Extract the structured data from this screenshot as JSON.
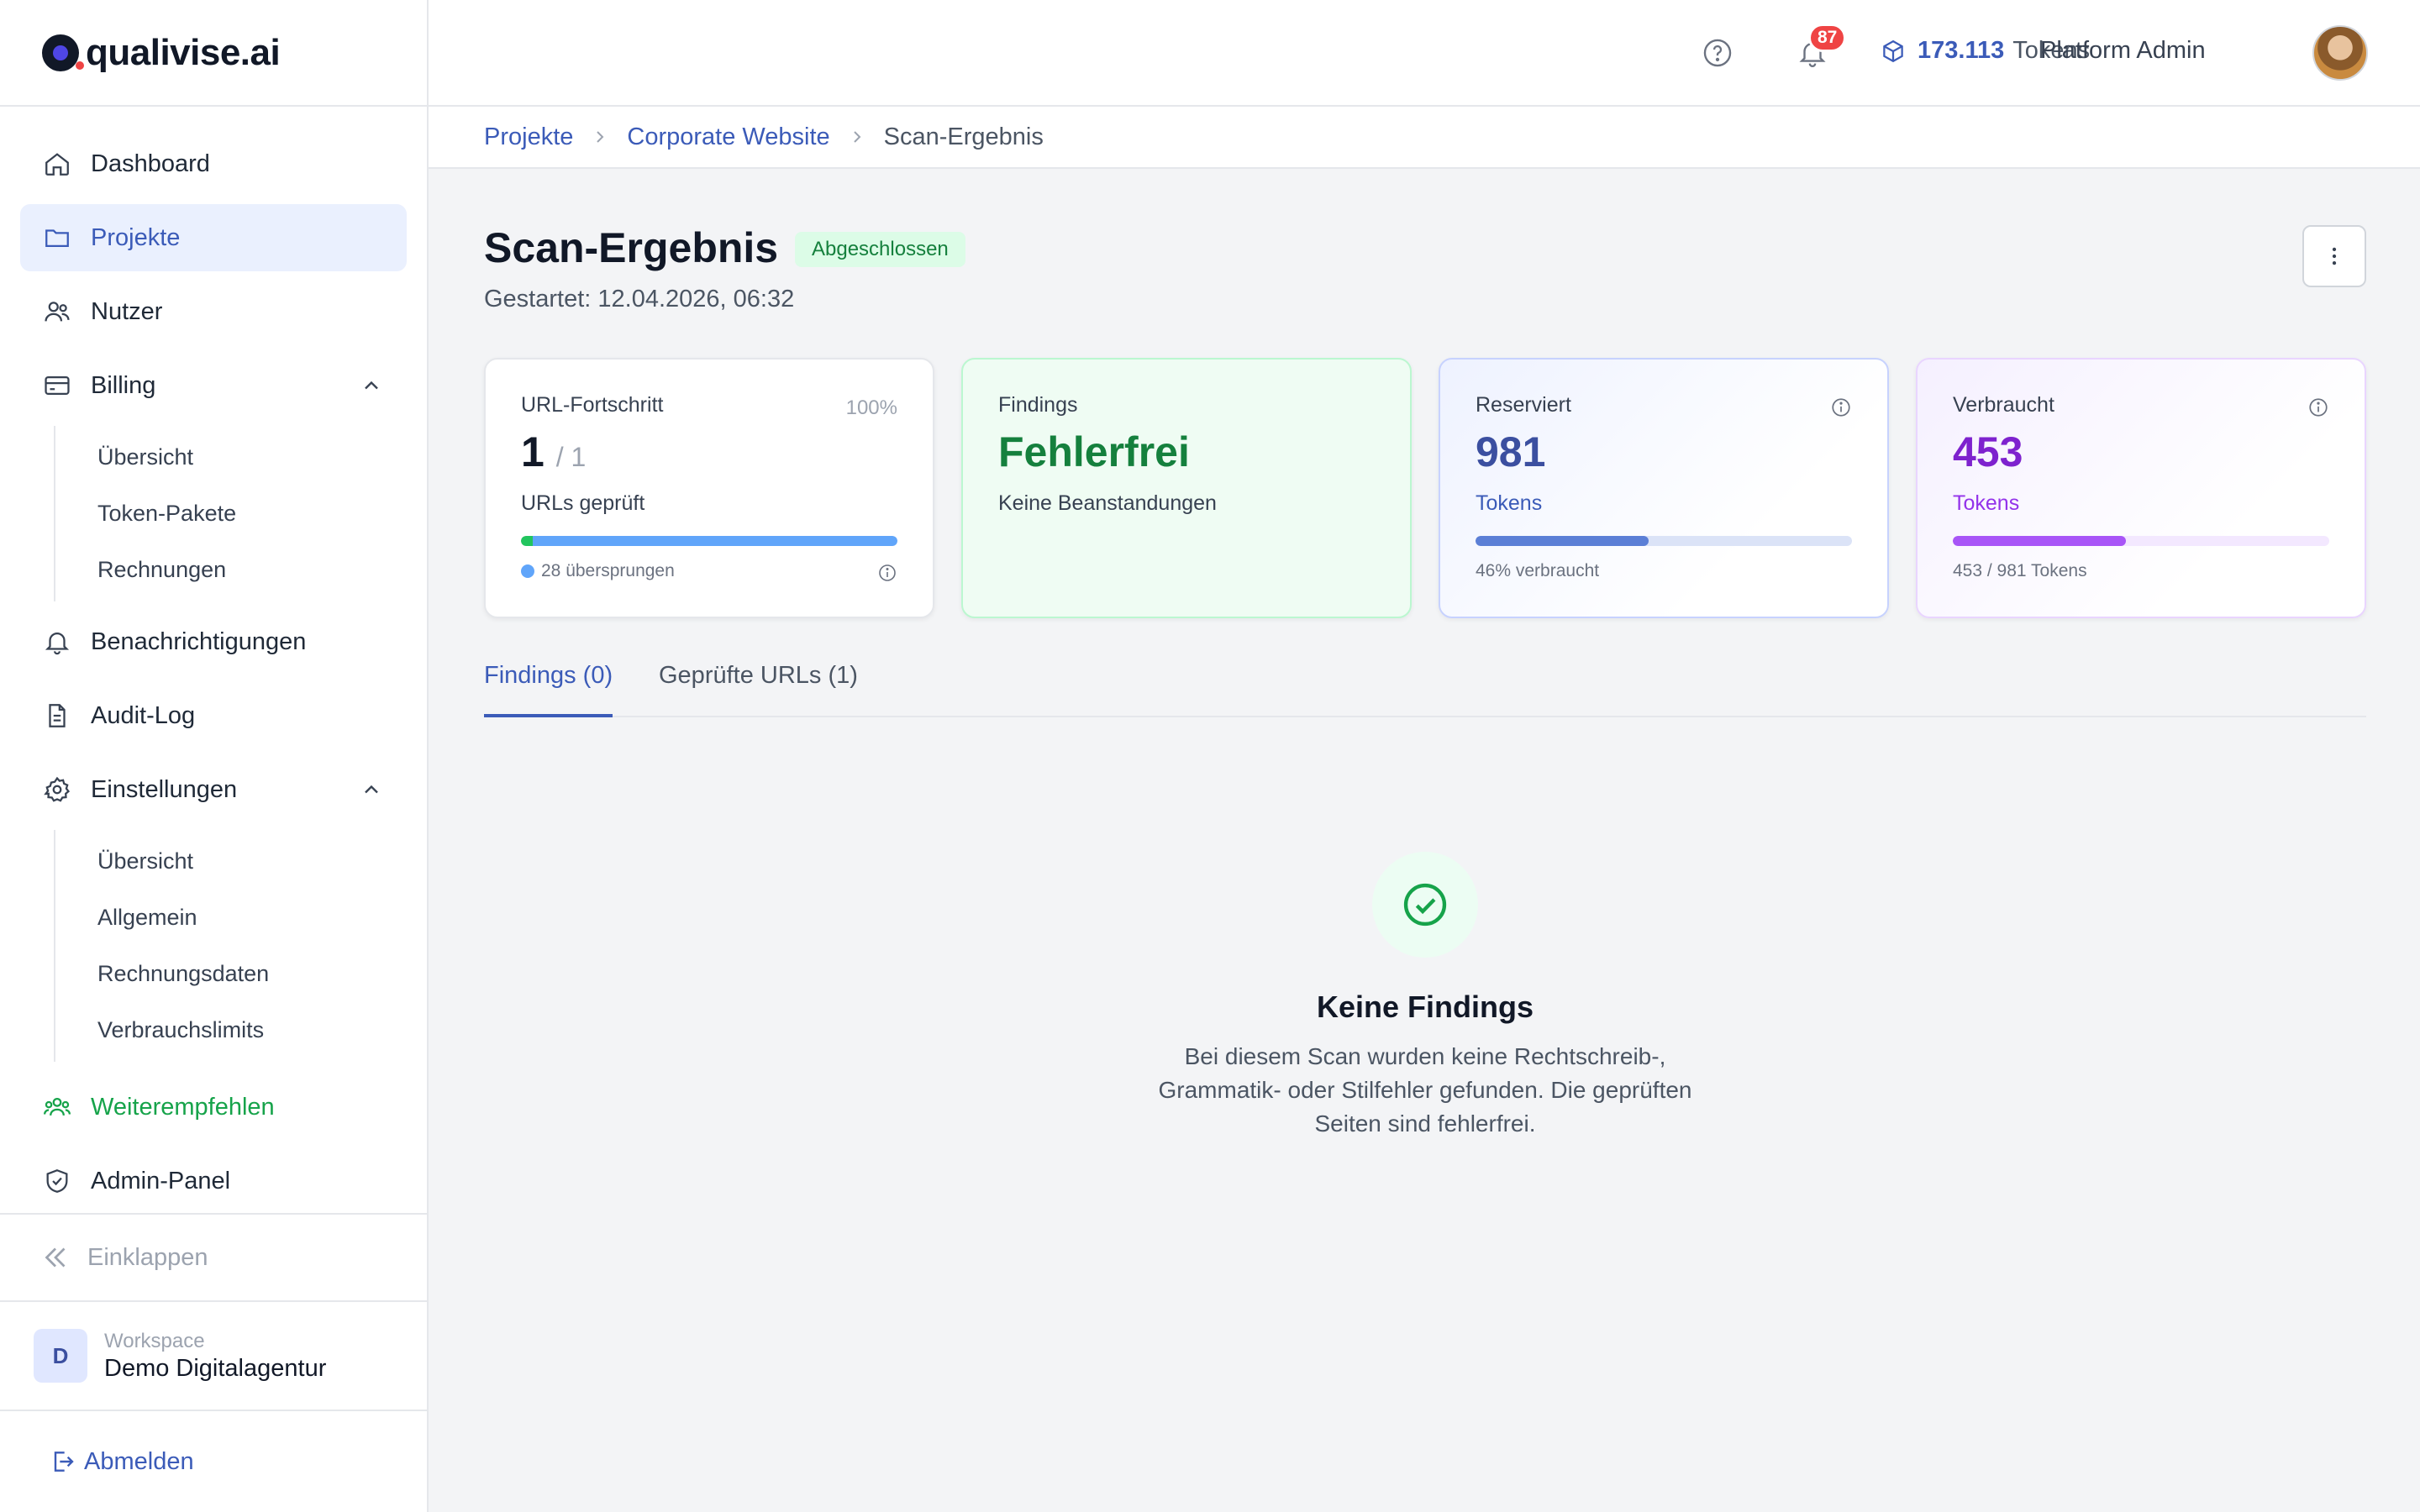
{
  "brand": {
    "logo_text": "qualivise.ai"
  },
  "sidebar": {
    "items": [
      {
        "label": "Dashboard",
        "icon": "home-icon"
      },
      {
        "label": "Projekte",
        "icon": "folder-icon",
        "active": true
      },
      {
        "label": "Nutzer",
        "icon": "users-icon"
      },
      {
        "label": "Billing",
        "icon": "credit-card-icon",
        "expanded": true,
        "children": [
          "Übersicht",
          "Token-Pakete",
          "Rechnungen"
        ]
      },
      {
        "label": "Benachrichtigungen",
        "icon": "bell-icon"
      },
      {
        "label": "Audit-Log",
        "icon": "document-icon"
      },
      {
        "label": "Einstellungen",
        "icon": "gear-icon",
        "expanded": true,
        "children": [
          "Übersicht",
          "Allgemein",
          "Rechnungsdaten",
          "Verbrauchslimits"
        ]
      },
      {
        "label": "Weiterempfehlen",
        "icon": "users-group-icon",
        "color": "#16a34a"
      },
      {
        "label": "Admin-Panel",
        "icon": "shield-icon"
      }
    ],
    "collapse_label": "Einklappen",
    "workspace": {
      "initial": "D",
      "label": "Workspace",
      "name": "Demo Digitalagentur"
    },
    "logout_label": "Abmelden"
  },
  "topbar": {
    "notification_count": "87",
    "tokens_value": "173.113",
    "tokens_label": "Tokens",
    "user_name": "Platform Admin"
  },
  "breadcrumb": [
    "Projekte",
    "Corporate Website",
    "Scan-Ergebnis"
  ],
  "page": {
    "title": "Scan-Ergebnis",
    "status": "Abgeschlossen",
    "started": "Gestartet: 12.04.2026, 06:32"
  },
  "cards": {
    "progress": {
      "label": "URL-Fortschritt",
      "percent": "100%",
      "value": "1",
      "total": "/ 1",
      "sub": "URLs geprüft",
      "progress_fraction": 1.0,
      "footer": "28 übersprungen"
    },
    "findings": {
      "label": "Findings",
      "value": "Fehlerfrei",
      "sub": "Keine Beanstandungen"
    },
    "reserved": {
      "label": "Reserviert",
      "value": "981",
      "sub": "Tokens",
      "progress_fraction": 0.46,
      "footer": "46% verbraucht"
    },
    "used": {
      "label": "Verbraucht",
      "value": "453",
      "sub": "Tokens",
      "progress_fraction": 0.46,
      "footer": "453 / 981 Tokens"
    }
  },
  "tabs": [
    {
      "label": "Findings (0)",
      "active": true
    },
    {
      "label": "Geprüfte URLs (1)",
      "active": false
    }
  ],
  "empty": {
    "title": "Keine Findings",
    "description": "Bei diesem Scan wurden keine Rechtschreib-, Grammatik- oder Stilfehler gefunden. Die geprüften Seiten sind fehlerfrei."
  },
  "colors": {
    "accent": "#3b5bb8",
    "success": "#16a34a",
    "purple": "#7e22ce",
    "badge": "#ef4444"
  }
}
